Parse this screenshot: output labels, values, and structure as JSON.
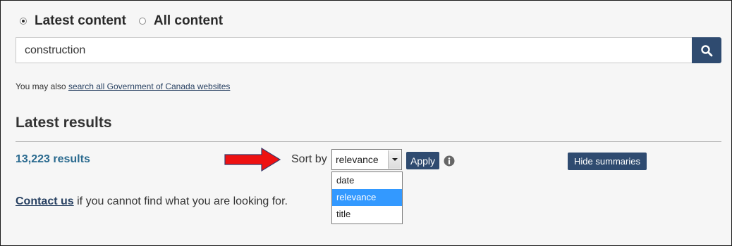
{
  "scope": {
    "options": [
      {
        "label": "Latest content",
        "checked": true
      },
      {
        "label": "All content",
        "checked": false
      }
    ]
  },
  "search": {
    "value": "construction",
    "button_icon": "search-icon"
  },
  "also": {
    "prefix": "You may also ",
    "link": "search all Government of Canada websites"
  },
  "results": {
    "heading": "Latest results",
    "count": "13,223 results"
  },
  "sort": {
    "label": "Sort by",
    "selected": "relevance",
    "options": [
      "date",
      "relevance",
      "title"
    ],
    "apply_label": "Apply",
    "info_icon": "info-icon"
  },
  "summaries_button": "Hide summaries",
  "contact": {
    "link": "Contact us",
    "suffix": " if you cannot find what you are looking for."
  },
  "annotation": {
    "arrow_color": "#ee1111",
    "arrow_icon": "red-arrow-icon"
  },
  "colors": {
    "primary_button": "#2f4b70",
    "link": "#284162",
    "count": "#2a6a8f",
    "dropdown_highlight": "#3399ff"
  }
}
